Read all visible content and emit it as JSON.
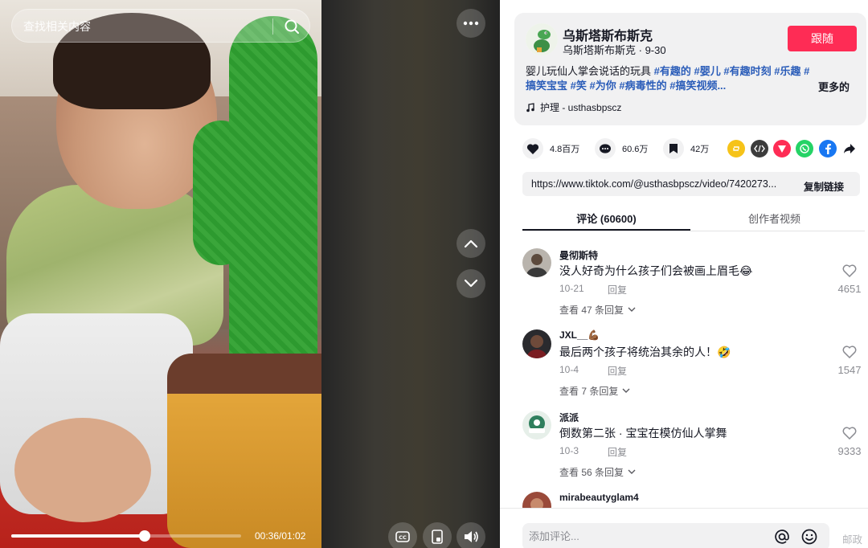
{
  "search": {
    "placeholder": "查找相关内容",
    "icon": "search-icon"
  },
  "player": {
    "current_time": "00:36",
    "duration": "01:02",
    "time_display": "00:36/01:02",
    "progress_fraction": 0.58
  },
  "author": {
    "name": "乌斯塔斯布斯克",
    "handle": "乌斯塔斯布斯克",
    "date": "9-30",
    "follow_label": "跟随"
  },
  "caption": {
    "text": "婴儿玩仙人掌会说话的玩具",
    "tags": [
      "#有趣的",
      "#婴儿",
      "#有趣时刻",
      "#乐趣",
      "#搞笑宝宝",
      "#笑",
      "#为你",
      "#病毒性的",
      "#搞笑视频..."
    ],
    "more_label": "更多的"
  },
  "music": {
    "label": "护理 - usthasbpscz"
  },
  "stats": {
    "likes": "4.8百万",
    "comments": "60.6万",
    "saves": "42万"
  },
  "share_colors": {
    "repost": "#f6c319",
    "embed": "#3c3c3c",
    "direct": "#fe2c55",
    "whatsapp": "#25d366",
    "facebook": "#1877f2"
  },
  "link": {
    "url": "https://www.tiktok.com/@usthasbpscz/video/7420273...",
    "copy_label": "复制链接"
  },
  "tabs": {
    "comments": "评论 (60600)",
    "creator_videos": "创作者视频"
  },
  "comments": [
    {
      "author": "曼彻斯特",
      "text": "没人好奇为什么孩子们会被画上眉毛😂",
      "date": "10-21",
      "reply": "回复",
      "likes": "4651",
      "view_replies": "查看 47 条回复"
    },
    {
      "author": "JXL__💪🏾",
      "text": "最后两个孩子将统治其余的人！🤣",
      "date": "10-4",
      "reply": "回复",
      "likes": "1547",
      "view_replies": "查看 7 条回复"
    },
    {
      "author": "派派",
      "text": "倒数第二张 · 宝宝在模仿仙人掌舞",
      "date": "10-3",
      "reply": "回复",
      "likes": "9333",
      "view_replies": "查看 56 条回复"
    },
    {
      "author": "mirabeautyglam4"
    }
  ],
  "comment_bar": {
    "placeholder": "添加评论...",
    "post_label": "邮政"
  },
  "accent": "#fe2c55"
}
